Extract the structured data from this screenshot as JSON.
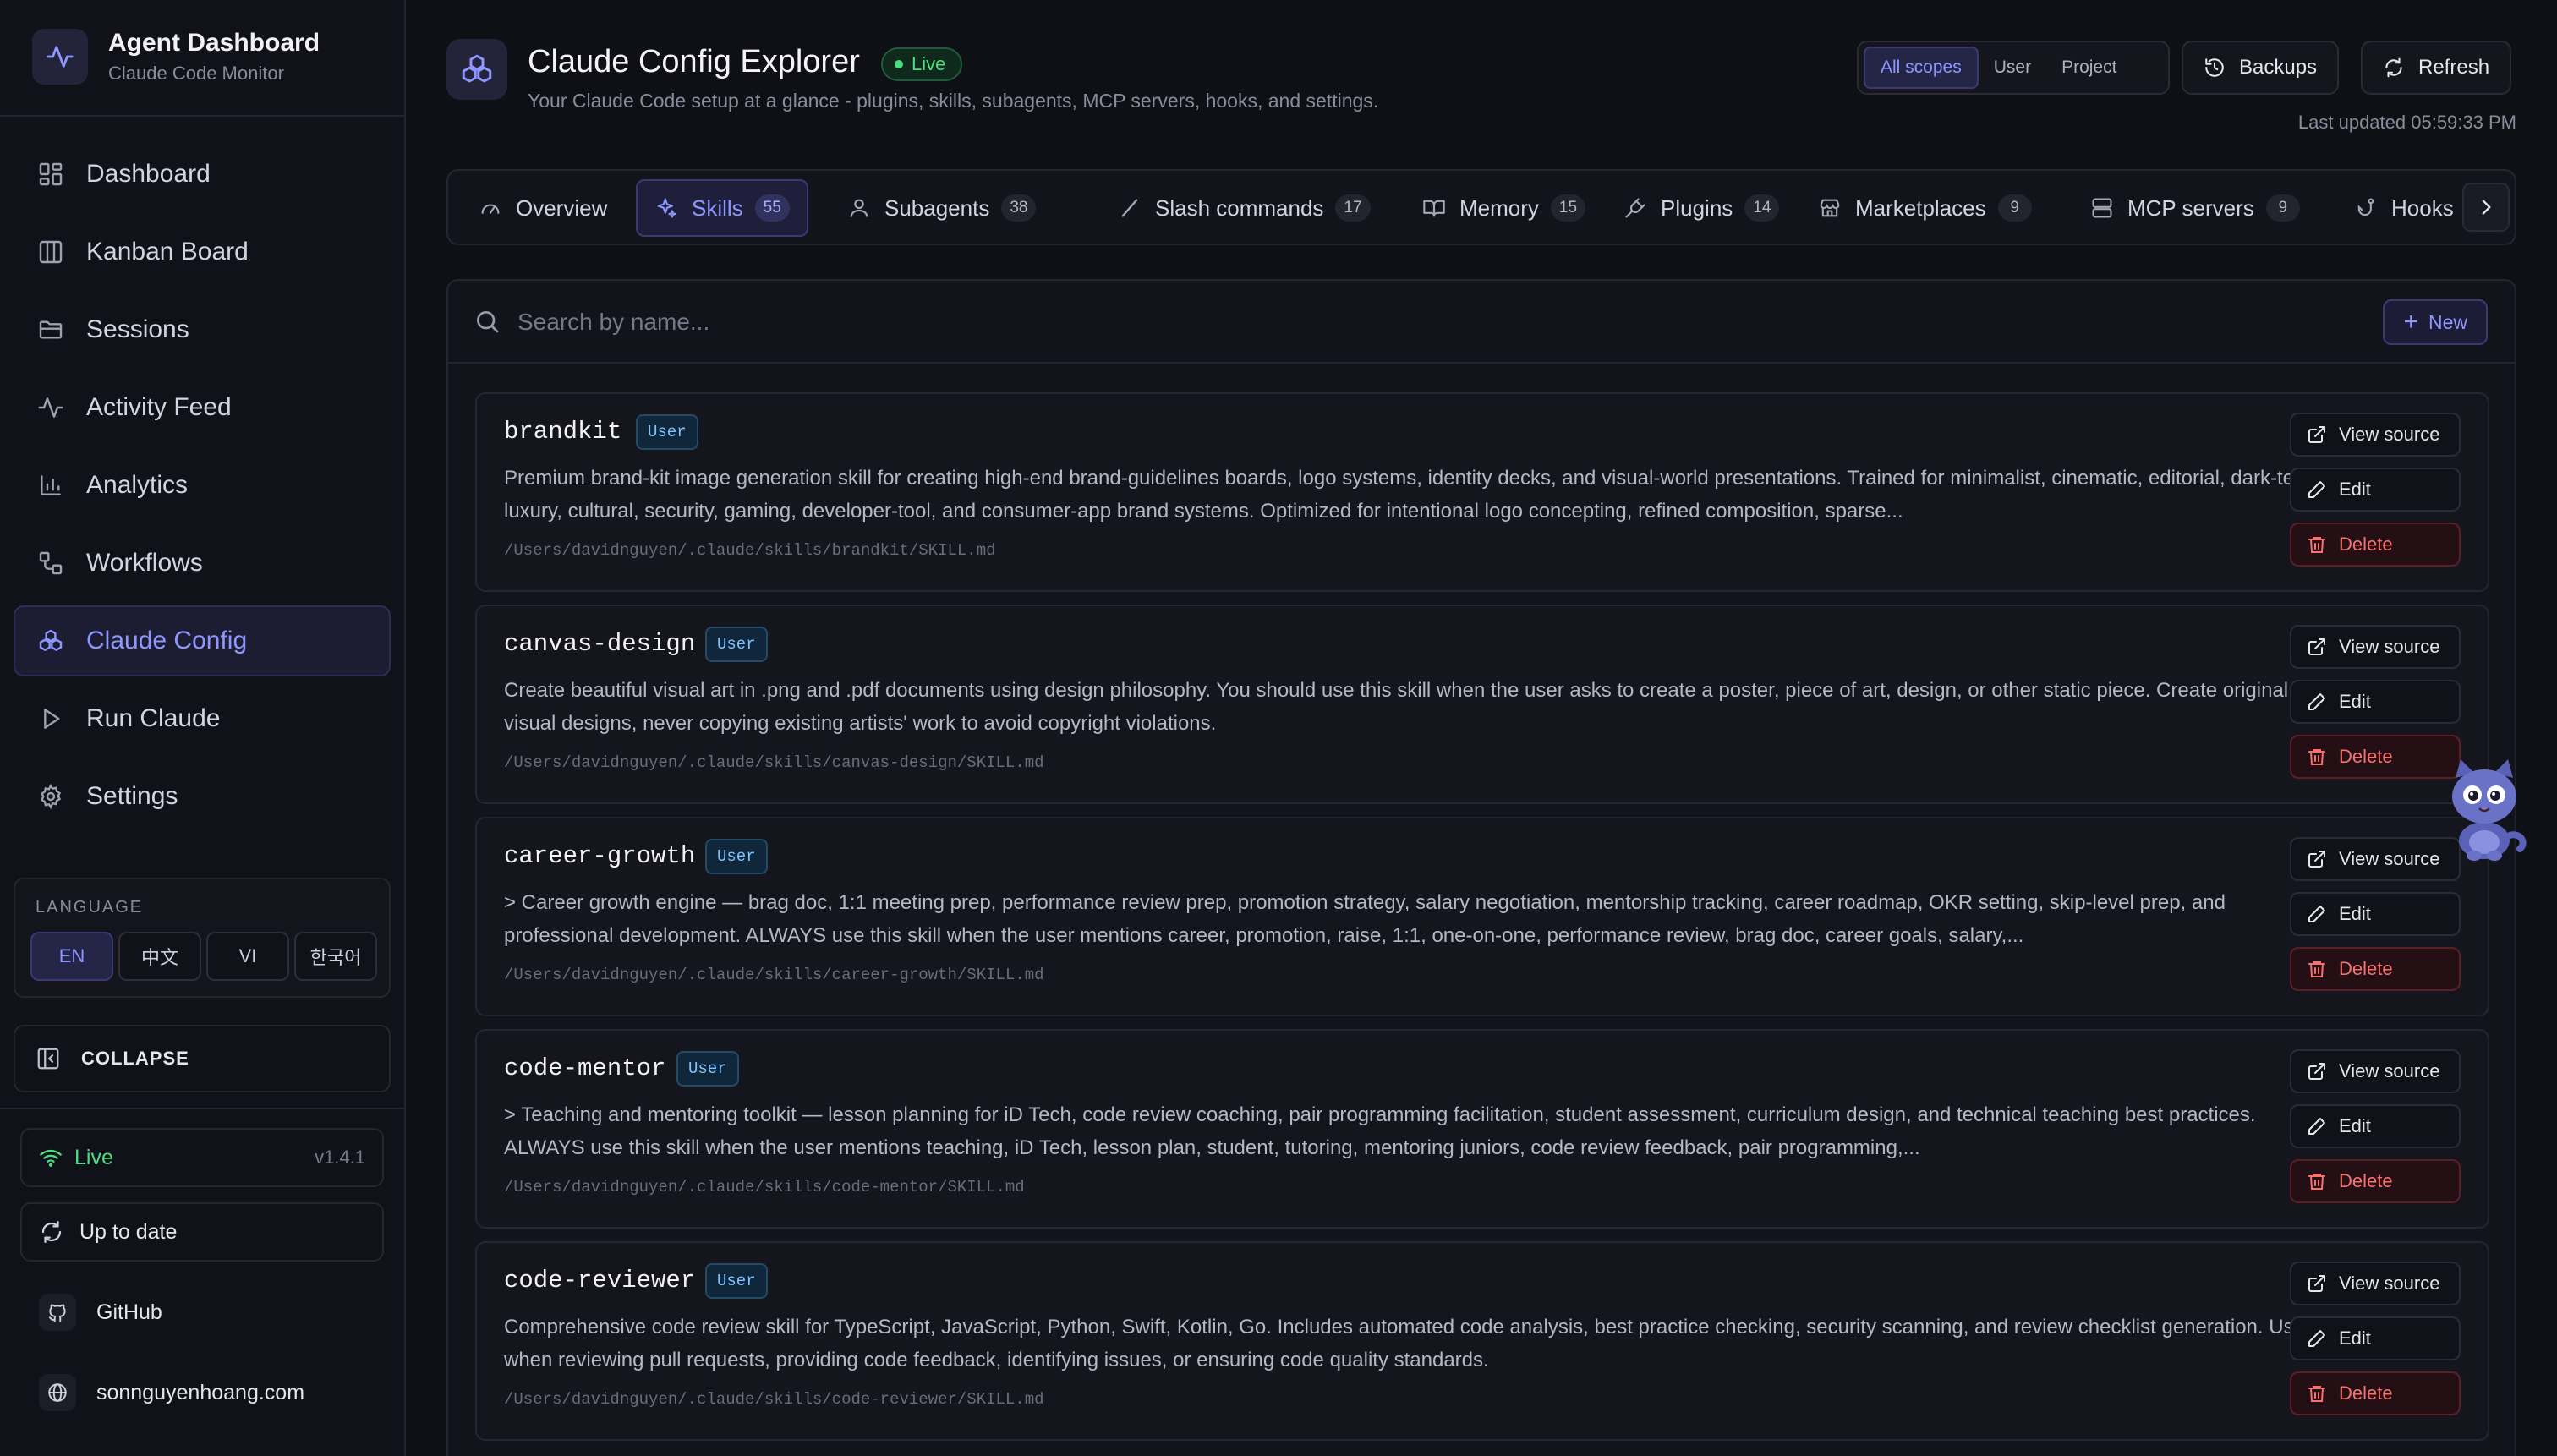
{
  "sidebar": {
    "brand_title": "Agent Dashboard",
    "brand_subtitle": "Claude Code Monitor",
    "nav": [
      {
        "label": "Dashboard",
        "icon": "grid-icon"
      },
      {
        "label": "Kanban Board",
        "icon": "kanban-icon"
      },
      {
        "label": "Sessions",
        "icon": "folder-icon"
      },
      {
        "label": "Activity Feed",
        "icon": "activity-icon"
      },
      {
        "label": "Analytics",
        "icon": "bar-chart-icon"
      },
      {
        "label": "Workflows",
        "icon": "workflow-icon"
      },
      {
        "label": "Claude Config",
        "icon": "boxes-icon",
        "active": true
      },
      {
        "label": "Run Claude",
        "icon": "play-icon"
      },
      {
        "label": "Settings",
        "icon": "gear-icon"
      }
    ],
    "language_title": "LANGUAGE",
    "languages": [
      "EN",
      "中文",
      "VI",
      "한국어"
    ],
    "active_language": "EN",
    "collapse_label": "COLLAPSE",
    "status_label": "Live",
    "version": "v1.4.1",
    "update_label": "Up to date",
    "github_label": "GitHub",
    "website_label": "sonnguyenhoang.com"
  },
  "header": {
    "title": "Claude Config Explorer",
    "live_badge": "Live",
    "subtitle": "Your Claude Code setup at a glance - plugins, skills, subagents, MCP servers, hooks, and settings.",
    "scopes": [
      "All scopes",
      "User",
      "Project"
    ],
    "active_scope": "All scopes",
    "backups_label": "Backups",
    "refresh_label": "Refresh",
    "last_updated": "Last updated 05:59:33 PM"
  },
  "tabs": [
    {
      "label": "Overview",
      "count": null,
      "icon": "gauge-icon"
    },
    {
      "label": "Skills",
      "count": "55",
      "icon": "sparkles-icon",
      "active": true
    },
    {
      "label": "Subagents",
      "count": "38",
      "icon": "user-icon"
    },
    {
      "label": "Slash commands",
      "count": "17",
      "icon": "slash-icon"
    },
    {
      "label": "Memory",
      "count": "15",
      "icon": "book-icon"
    },
    {
      "label": "Plugins",
      "count": "14",
      "icon": "plug-icon"
    },
    {
      "label": "Marketplaces",
      "count": "9",
      "icon": "store-icon"
    },
    {
      "label": "MCP servers",
      "count": "9",
      "icon": "server-icon"
    },
    {
      "label": "Hooks",
      "count": null,
      "icon": "hook-icon"
    }
  ],
  "search": {
    "placeholder": "Search by name..."
  },
  "new_label": "New",
  "actions": {
    "view_source": "View source",
    "edit": "Edit",
    "delete": "Delete"
  },
  "skills": [
    {
      "name": "brandkit",
      "scope": "User",
      "description": "Premium brand-kit image generation skill for creating high-end brand-guidelines boards, logo systems, identity decks, and visual-world presentations. Trained for minimalist, cinematic, editorial, dark-tech, luxury, cultural, security, gaming, developer-tool, and consumer-app brand systems. Optimized for intentional logo concepting, refined composition, sparse...",
      "path": "/Users/davidnguyen/.claude/skills/brandkit/SKILL.md"
    },
    {
      "name": "canvas-design",
      "scope": "User",
      "description": "Create beautiful visual art in .png and .pdf documents using design philosophy. You should use this skill when the user asks to create a poster, piece of art, design, or other static piece. Create original visual designs, never copying existing artists' work to avoid copyright violations.",
      "path": "/Users/davidnguyen/.claude/skills/canvas-design/SKILL.md"
    },
    {
      "name": "career-growth",
      "scope": "User",
      "description": "> Career growth engine — brag doc, 1:1 meeting prep, performance review prep, promotion strategy, salary negotiation, mentorship tracking, career roadmap, OKR setting, skip-level prep, and professional development. ALWAYS use this skill when the user mentions career, promotion, raise, 1:1, one-on-one, performance review, brag doc, career goals, salary,...",
      "path": "/Users/davidnguyen/.claude/skills/career-growth/SKILL.md"
    },
    {
      "name": "code-mentor",
      "scope": "User",
      "description": "> Teaching and mentoring toolkit — lesson planning for iD Tech, code review coaching, pair programming facilitation, student assessment, curriculum design, and technical teaching best practices. ALWAYS use this skill when the user mentions teaching, iD Tech, lesson plan, student, tutoring, mentoring juniors, code review feedback, pair programming,...",
      "path": "/Users/davidnguyen/.claude/skills/code-mentor/SKILL.md"
    },
    {
      "name": "code-reviewer",
      "scope": "User",
      "description": "Comprehensive code review skill for TypeScript, JavaScript, Python, Swift, Kotlin, Go. Includes automated code analysis, best practice checking, security scanning, and review checklist generation. Use when reviewing pull requests, providing code feedback, identifying issues, or ensuring code quality standards.",
      "path": "/Users/davidnguyen/.claude/skills/code-reviewer/SKILL.md"
    }
  ]
}
